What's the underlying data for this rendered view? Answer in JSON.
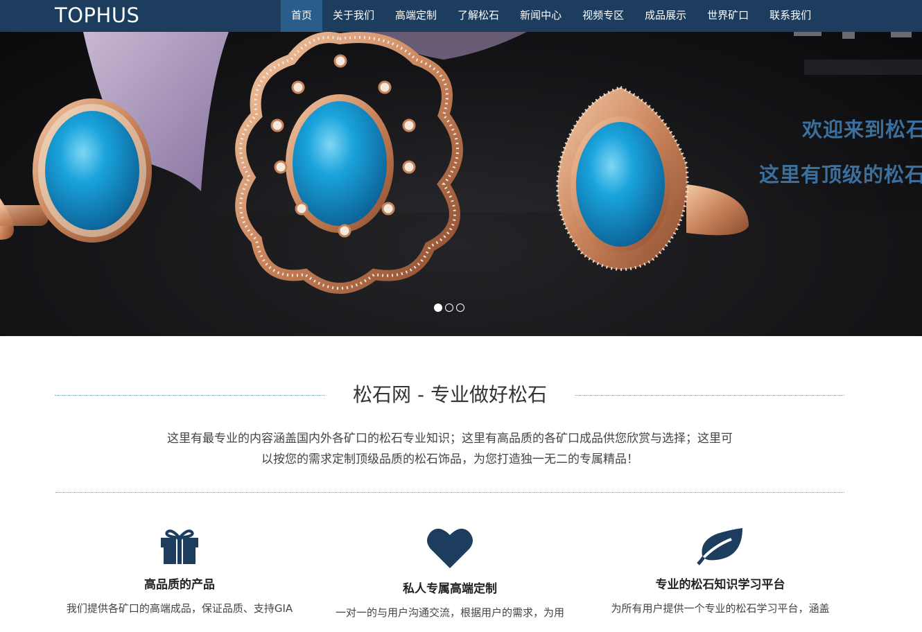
{
  "header": {
    "logo": "TOPHUS",
    "nav": [
      "首页",
      "关于我们",
      "高端定制",
      "了解松石",
      "新闻中心",
      "视频专区",
      "成品展示",
      "世界矿口",
      "联系我们"
    ],
    "active_index": 0
  },
  "banner": {
    "line1": "欢迎来到松石",
    "line2": "这里有顶级的松石",
    "slides": 3,
    "active_slide": 0
  },
  "intro": {
    "title": "松石网 - 专业做好松石",
    "text": "这里有最专业的内容涵盖国内外各矿口的松石专业知识；这里有高品质的各矿口成品供您欣赏与选择；这里可以按您的需求定制顶级品质的松石饰品，为您打造独一无二的专属精品！"
  },
  "features": [
    {
      "icon": "gift-icon",
      "title": "高品质的产品",
      "desc": "我们提供各矿口的高端成品，保证品质、支持GIA"
    },
    {
      "icon": "heart-icon",
      "title": "私人专属高端定制",
      "desc": "一对一的与用户沟通交流，根据用户的需求，为用"
    },
    {
      "icon": "leaf-icon",
      "title": "专业的松石知识学习平台",
      "desc": "为所有用户提供一个专业的松石学习平台，涵盖"
    }
  ],
  "colors": {
    "navbar": "#1c3d5e",
    "nav_active": "#2b5d8a",
    "icon": "#1c3d5e",
    "banner_text": "#3b6f9e"
  }
}
